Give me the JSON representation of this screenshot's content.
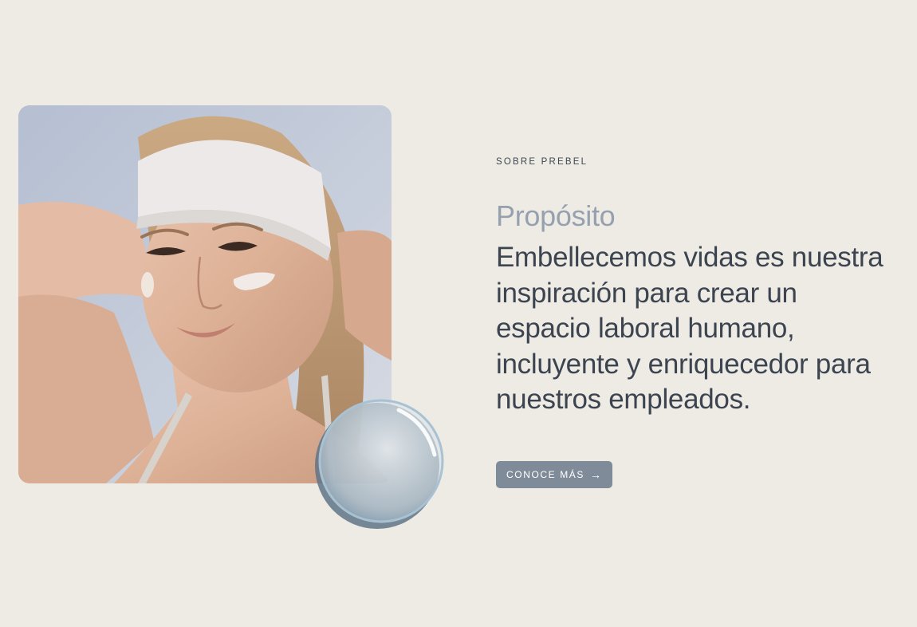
{
  "about": {
    "eyebrow": "SOBRE PREBEL",
    "section_title": "Propósito",
    "headline": "Embellecemos vidas es nuestra inspiración para crear un espacio laboral humano, incluyente y enriquecedor para nuestros empleados.",
    "cta_label": "CONOCE MÁS",
    "cta_icon": "arrow-right-icon"
  },
  "colors": {
    "background": "#eeebe5",
    "heading_muted": "#96a0ae",
    "text_dark": "#3c4450",
    "button_bg": "#808b9a",
    "button_text": "#ffffff"
  }
}
